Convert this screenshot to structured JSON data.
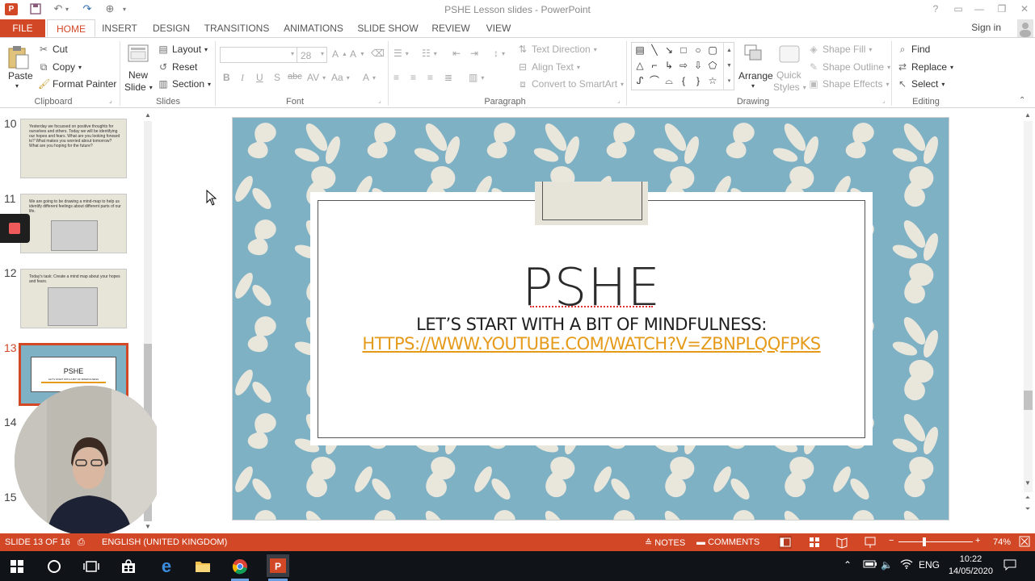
{
  "window": {
    "title": "PSHE Lesson slides - PowerPoint",
    "controls": [
      "?",
      "restore",
      "minimize",
      "maximize",
      "close"
    ]
  },
  "qat": [
    "save-icon",
    "undo-icon",
    "redo-icon",
    "touch-mode-icon"
  ],
  "tabs": {
    "file": "FILE",
    "items": [
      "HOME",
      "INSERT",
      "DESIGN",
      "TRANSITIONS",
      "ANIMATIONS",
      "SLIDE SHOW",
      "REVIEW",
      "VIEW"
    ],
    "active": "HOME",
    "signin": "Sign in"
  },
  "ribbon": {
    "clipboard": {
      "label": "Clipboard",
      "paste": "Paste",
      "cut": "Cut",
      "copy": "Copy",
      "format_painter": "Format Painter"
    },
    "slides": {
      "label": "Slides",
      "new_slide_1": "New",
      "new_slide_2": "Slide",
      "layout": "Layout",
      "reset": "Reset",
      "section": "Section"
    },
    "font": {
      "label": "Font",
      "font_name": "",
      "font_size": "28",
      "bold": "B",
      "italic": "I",
      "underline": "U",
      "shadow": "S",
      "strike": "abc"
    },
    "paragraph": {
      "label": "Paragraph",
      "text_direction": "Text Direction",
      "align_text": "Align Text",
      "convert_smartart": "Convert to SmartArt"
    },
    "drawing": {
      "label": "Drawing",
      "arrange": "Arrange",
      "quick_styles_1": "Quick",
      "quick_styles_2": "Styles",
      "shape_fill": "Shape Fill",
      "shape_outline": "Shape Outline",
      "shape_effects": "Shape Effects"
    },
    "editing": {
      "label": "Editing",
      "find": "Find",
      "replace": "Replace",
      "select": "Select"
    }
  },
  "thumbnails": [
    {
      "num": "10",
      "text": "Yesterday we focussed on positive thoughts for ourselves and others. Today we will be identifying our hopes and fears. What are you looking forward to? What makes you worried about tomorrow? What are you hoping for the future?"
    },
    {
      "num": "11",
      "text": "We are going to be drawing a mind-map to help us identify different feelings about different parts of our life."
    },
    {
      "num": "12",
      "text": "Today's task: Create a mind map about your hopes and fears."
    },
    {
      "num": "13",
      "text": "PSHE",
      "sub": "LET'S START WITH A BIT OF MINDFULNESS"
    },
    {
      "num": "14",
      "text": ""
    },
    {
      "num": "15",
      "text": ""
    }
  ],
  "slide": {
    "title": "PSHE",
    "subtitle": "LET’S START WITH A BIT OF MINDFULNESS:",
    "link": "HTTPS://WWW.YOUTUBE.COM/WATCH?V=ZBNPLQQFPKS",
    "colors": {
      "background": "#7fb1c4",
      "pattern": "#e9e6dc",
      "link": "#e59a19"
    }
  },
  "statusbar": {
    "slide_info": "SLIDE 13 OF 16",
    "language": "ENGLISH (UNITED KINGDOM)",
    "notes": "NOTES",
    "comments": "COMMENTS",
    "zoom": "74%"
  },
  "taskbar": {
    "apps": [
      "windows-start-icon",
      "cortana-icon",
      "task-view-icon",
      "store-icon",
      "edge-icon",
      "file-explorer-icon",
      "chrome-icon",
      "powerpoint-icon"
    ],
    "lang": "ENG",
    "time": "10:22",
    "date": "14/05/2020"
  }
}
